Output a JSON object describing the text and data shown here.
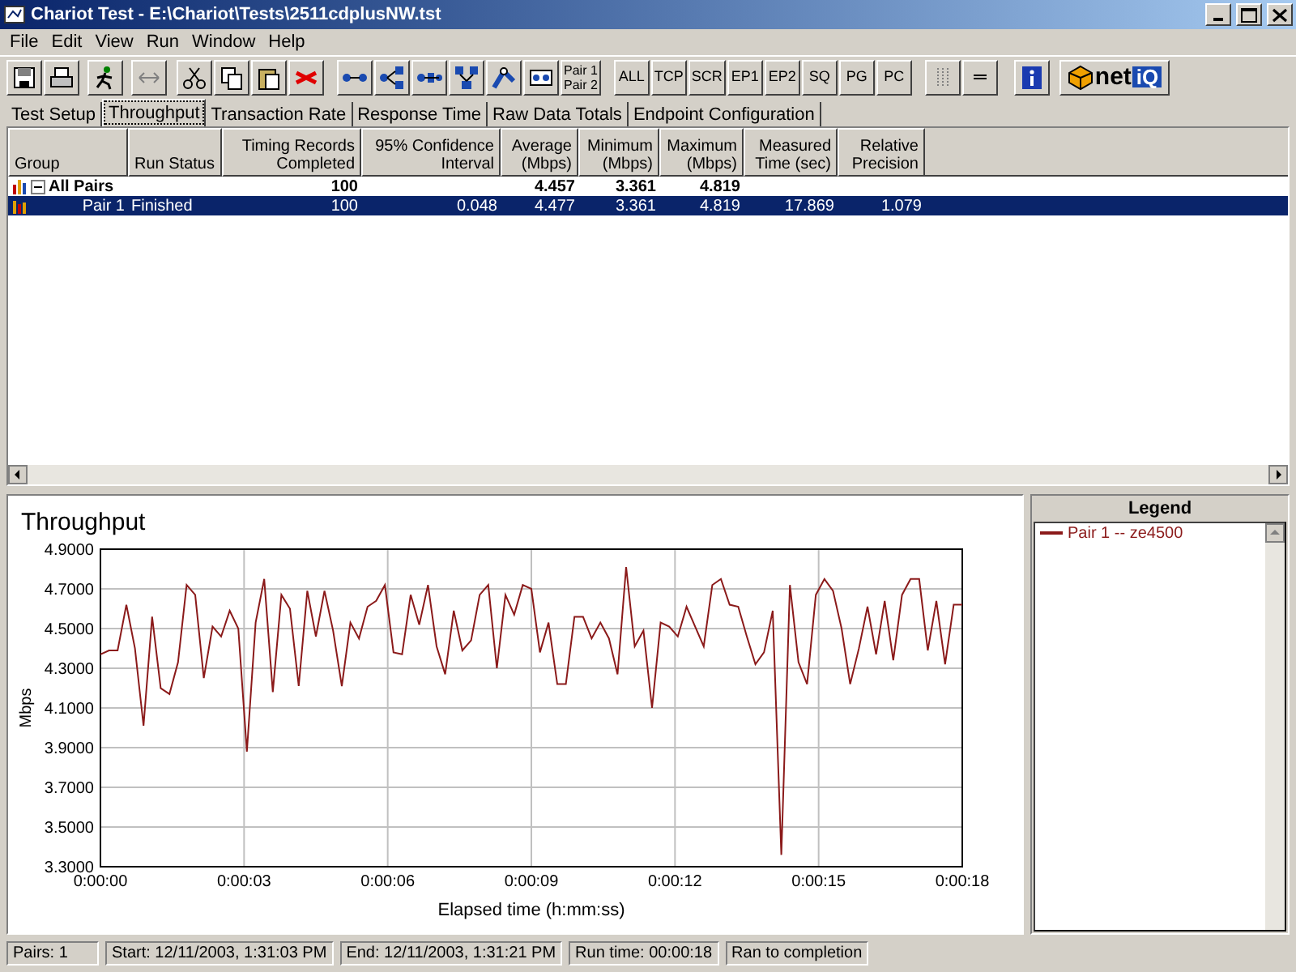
{
  "window": {
    "title": "Chariot Test - E:\\Chariot\\Tests\\2511cdplusNW.tst"
  },
  "menu": [
    "File",
    "Edit",
    "View",
    "Run",
    "Window",
    "Help"
  ],
  "toolbar": {
    "pair_button": [
      "Pair 1",
      "Pair 2"
    ],
    "filter_buttons": [
      "ALL",
      "TCP",
      "SCR",
      "EP1",
      "EP2",
      "SQ",
      "PG",
      "PC"
    ],
    "logo": [
      "net",
      "iQ"
    ]
  },
  "tabs": [
    {
      "label": "Test Setup",
      "selected": false
    },
    {
      "label": "Throughput",
      "selected": true
    },
    {
      "label": "Transaction Rate",
      "selected": false
    },
    {
      "label": "Response Time",
      "selected": false
    },
    {
      "label": "Raw Data Totals",
      "selected": false
    },
    {
      "label": "Endpoint Configuration",
      "selected": false
    }
  ],
  "table": {
    "columns": [
      "Group",
      "Run Status",
      "Timing Records Completed",
      "95% Confidence Interval",
      "Average (Mbps)",
      "Minimum (Mbps)",
      "Maximum (Mbps)",
      "Measured Time (sec)",
      "Relative Precision"
    ],
    "rows": [
      {
        "kind": "group",
        "expanded": true,
        "selected": false,
        "cells": [
          "All Pairs",
          "",
          "100",
          "",
          "4.457",
          "3.361",
          "4.819",
          "",
          ""
        ]
      },
      {
        "kind": "pair",
        "selected": true,
        "cells": [
          "Pair 1",
          "Finished",
          "100",
          "0.048",
          "4.477",
          "3.361",
          "4.819",
          "17.869",
          "1.079"
        ]
      }
    ]
  },
  "chart": {
    "chart_data": {
      "type": "line",
      "grid": true,
      "title": "Throughput",
      "xlabel": "Elapsed time (h:mm:ss)",
      "ylabel": "Mbps",
      "xlim": [
        0,
        18
      ],
      "ylim": [
        3.3,
        4.9
      ],
      "xticks": [
        {
          "value": 0,
          "label": "0:00:00"
        },
        {
          "value": 3,
          "label": "0:00:03"
        },
        {
          "value": 6,
          "label": "0:00:06"
        },
        {
          "value": 9,
          "label": "0:00:09"
        },
        {
          "value": 12,
          "label": "0:00:12"
        },
        {
          "value": 15,
          "label": "0:00:15"
        },
        {
          "value": 18,
          "label": "0:00:18"
        }
      ],
      "yticks": [
        {
          "value": 3.3,
          "label": "3.3000"
        },
        {
          "value": 3.5,
          "label": "3.5000"
        },
        {
          "value": 3.7,
          "label": "3.7000"
        },
        {
          "value": 3.9,
          "label": "3.9000"
        },
        {
          "value": 4.1,
          "label": "4.1000"
        },
        {
          "value": 4.3,
          "label": "4.3000"
        },
        {
          "value": 4.5,
          "label": "4.5000"
        },
        {
          "value": 4.7,
          "label": "4.7000"
        },
        {
          "value": 4.9,
          "label": "4.9000"
        }
      ],
      "x": [
        0,
        0.18,
        0.36,
        0.54,
        0.72,
        0.9,
        1.08,
        1.26,
        1.44,
        1.62,
        1.8,
        1.98,
        2.16,
        2.34,
        2.52,
        2.7,
        2.88,
        3.06,
        3.24,
        3.42,
        3.6,
        3.78,
        3.96,
        4.14,
        4.32,
        4.5,
        4.68,
        4.86,
        5.04,
        5.22,
        5.4,
        5.58,
        5.76,
        5.94,
        6.12,
        6.3,
        6.48,
        6.66,
        6.84,
        7.02,
        7.2,
        7.38,
        7.56,
        7.74,
        7.92,
        8.1,
        8.28,
        8.46,
        8.64,
        8.82,
        9,
        9.18,
        9.36,
        9.54,
        9.72,
        9.9,
        10.08,
        10.26,
        10.44,
        10.62,
        10.8,
        10.98,
        11.16,
        11.34,
        11.52,
        11.7,
        11.88,
        12.06,
        12.24,
        12.42,
        12.6,
        12.78,
        12.96,
        13.14,
        13.32,
        13.5,
        13.68,
        13.86,
        14.04,
        14.22,
        14.4,
        14.58,
        14.76,
        14.94,
        15.12,
        15.3,
        15.48,
        15.66,
        15.84,
        16.02,
        16.2,
        16.38,
        16.56,
        16.74,
        16.92,
        17.1,
        17.28,
        17.46,
        17.64,
        17.82,
        18
      ],
      "series": [
        {
          "name": "Pair 1 -- ze4500",
          "color": "#8b1a1a",
          "values": [
            4.37,
            4.39,
            4.39,
            4.62,
            4.4,
            4.01,
            4.56,
            4.2,
            4.17,
            4.33,
            4.72,
            4.67,
            4.25,
            4.51,
            4.46,
            4.59,
            4.5,
            3.88,
            4.53,
            4.75,
            4.18,
            4.67,
            4.6,
            4.21,
            4.69,
            4.46,
            4.69,
            4.49,
            4.21,
            4.53,
            4.45,
            4.61,
            4.64,
            4.72,
            4.38,
            4.37,
            4.67,
            4.52,
            4.72,
            4.41,
            4.27,
            4.59,
            4.39,
            4.44,
            4.67,
            4.72,
            4.3,
            4.67,
            4.57,
            4.72,
            4.7,
            4.38,
            4.53,
            4.22,
            4.22,
            4.56,
            4.56,
            4.45,
            4.53,
            4.45,
            4.27,
            4.81,
            4.41,
            4.49,
            4.1,
            4.53,
            4.51,
            4.46,
            4.61,
            4.51,
            4.41,
            4.72,
            4.75,
            4.62,
            4.61,
            4.46,
            4.32,
            4.38,
            4.59,
            3.36,
            4.72,
            4.33,
            4.22,
            4.67,
            4.75,
            4.69,
            4.5,
            4.22,
            4.4,
            4.61,
            4.37,
            4.64,
            4.34,
            4.67,
            4.75,
            4.75,
            4.39,
            4.64,
            4.32,
            4.62,
            4.62
          ]
        }
      ]
    }
  },
  "legend": {
    "title": "Legend"
  },
  "status_bar": [
    "Pairs: 1",
    "Start: 12/11/2003, 1:31:03 PM",
    "End: 12/11/2003, 1:31:21 PM",
    "Run time: 00:00:18",
    "Ran to completion"
  ]
}
